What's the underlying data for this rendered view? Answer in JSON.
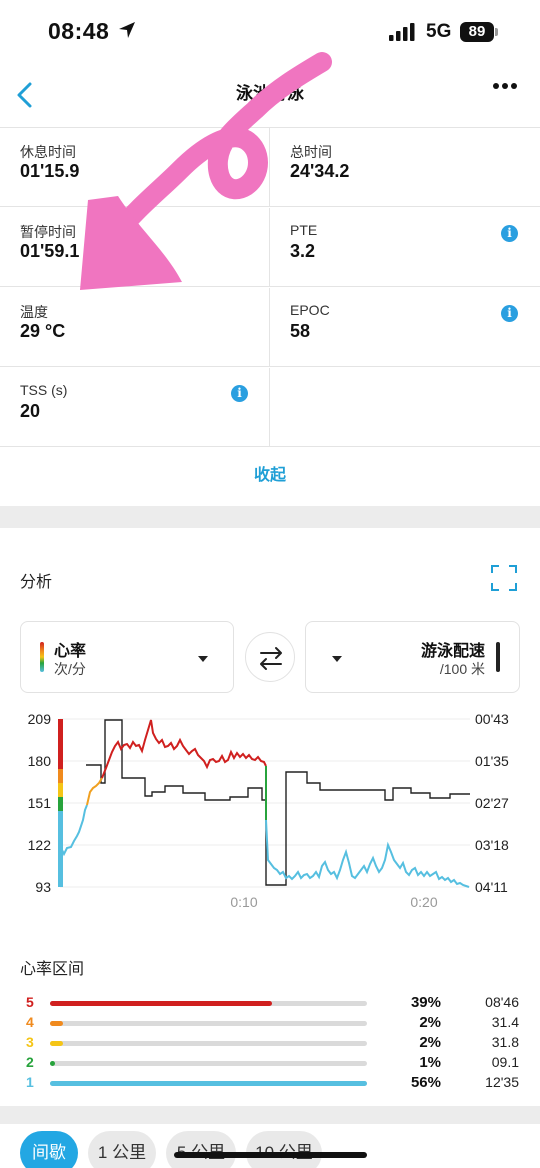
{
  "status_bar": {
    "time": "08:48",
    "network": "5G",
    "battery": "89"
  },
  "nav": {
    "title": "泳池游泳",
    "back_icon": "chevron-left-icon",
    "more_icon": "more-dots-icon"
  },
  "metrics": [
    {
      "label": "休息时间",
      "value": "01'15.9"
    },
    {
      "label": "总时间",
      "value": "24'34.2"
    },
    {
      "label": "暂停时间",
      "value": "01'59.1"
    },
    {
      "label": "PTE",
      "value": "3.2"
    },
    {
      "label": "温度",
      "value": "29 °C"
    },
    {
      "label": "EPOC",
      "value": "58"
    },
    {
      "label": "TSS (s)",
      "value": "20"
    }
  ],
  "collapse_label": "收起",
  "analysis": {
    "title": "分析",
    "left_selector": {
      "main": "心率",
      "sub": "次/分"
    },
    "right_selector": {
      "main": "游泳配速",
      "sub": "/100 米"
    }
  },
  "chart_data": {
    "type": "line",
    "y_left_ticks": [
      "209",
      "180",
      "151",
      "122",
      "93"
    ],
    "y_right_ticks": [
      "00'43",
      "01'35",
      "02'27",
      "03'18",
      "04'11"
    ],
    "x_ticks": [
      "0:10",
      "0:20"
    ],
    "ylim_left": [
      93,
      209
    ],
    "series": [
      {
        "name": "心率",
        "unit": "次/分"
      },
      {
        "name": "游泳配速",
        "unit": "/100 米"
      }
    ]
  },
  "hr_zones": {
    "title": "心率区间",
    "zones": [
      {
        "zone": "5",
        "percent": "39%",
        "time": "08'46",
        "fraction": 0.7,
        "color": "#d0201f"
      },
      {
        "zone": "4",
        "percent": "2%",
        "time": "31.4",
        "fraction": 0.04,
        "color": "#f08a1d"
      },
      {
        "zone": "3",
        "percent": "2%",
        "time": "31.8",
        "fraction": 0.04,
        "color": "#f5c516"
      },
      {
        "zone": "2",
        "percent": "1%",
        "time": "09.1",
        "fraction": 0.015,
        "color": "#27a33c"
      },
      {
        "zone": "1",
        "percent": "56%",
        "time": "12'35",
        "fraction": 1.0,
        "color": "#56bfe0"
      }
    ]
  },
  "tabs": [
    "间歇",
    "1 公里",
    "5 公里",
    "10 公里"
  ],
  "colors": {
    "accent": "#23a7e3",
    "annotation": "#f075c0"
  }
}
